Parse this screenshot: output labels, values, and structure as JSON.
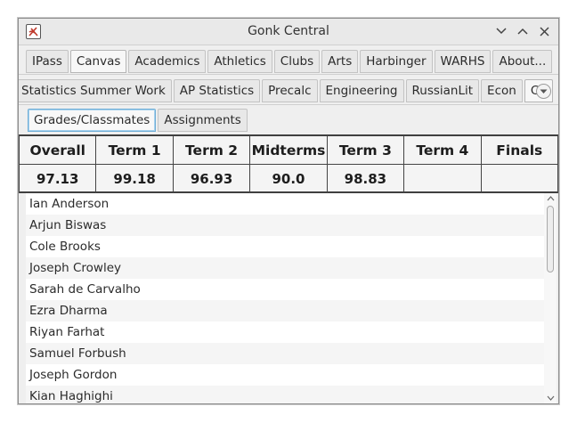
{
  "window": {
    "title": "Gonk Central"
  },
  "tabs_row1": [
    "IPass",
    "Canvas",
    "Academics",
    "Athletics",
    "Clubs",
    "Arts",
    "Harbinger",
    "WARHS",
    "About..."
  ],
  "tabs_row1_selected": "Canvas",
  "tabs_row2": [
    "Statistics Summer Work",
    "AP Statistics",
    "Precalc",
    "Engineering",
    "RussianLit",
    "Econ",
    "CS"
  ],
  "tabs_row2_selected": "CS",
  "subtabs": [
    "Grades/Classmates",
    "Assignments"
  ],
  "subtabs_selected": "Grades/Classmates",
  "grades": {
    "headers": [
      "Overall",
      "Term 1",
      "Term 2",
      "Midterms",
      "Term 3",
      "Term 4",
      "Finals"
    ],
    "values": [
      "97.13",
      "99.18",
      "96.93",
      "90.0",
      "98.83",
      "",
      ""
    ]
  },
  "classmates": [
    "Ian Anderson",
    "Arjun Biswas",
    "Cole Brooks",
    "Joseph Crowley",
    "Sarah de Carvalho",
    "Ezra Dharma",
    "Riyan Farhat",
    "Samuel Forbush",
    "Joseph Gordon",
    "Kian Haghighi"
  ]
}
